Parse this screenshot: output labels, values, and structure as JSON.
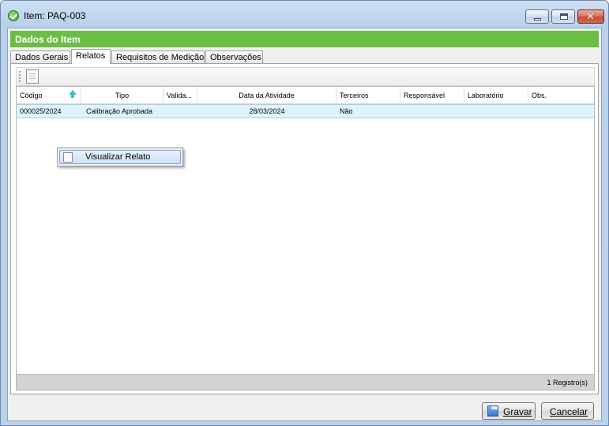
{
  "window": {
    "title": "Item: PAQ-003"
  },
  "section": {
    "header": "Dados do Item"
  },
  "tabs": [
    {
      "label": "Dados Gerais",
      "active": false
    },
    {
      "label": "Relatos",
      "active": true
    },
    {
      "label": "Requisitos de Medição",
      "active": false
    },
    {
      "label": "Observações",
      "active": false
    }
  ],
  "grid": {
    "columns": [
      "Código",
      "Tipo",
      "Valida...",
      "Data da Atividade",
      "Terceiros",
      "Responsável",
      "Laboratório",
      "Obs."
    ],
    "sort_column": "Código",
    "rows": [
      {
        "codigo": "000025/2024",
        "tipo": "Calibração Aprobada",
        "validade": "",
        "data": "28/03/2024",
        "terceiros": "Não",
        "responsavel": "",
        "laboratorio": "",
        "obs": ""
      }
    ],
    "footer": "1  Registro(s)"
  },
  "context_menu": {
    "items": [
      {
        "label": "Visualizar Relato",
        "icon": "document-icon"
      }
    ]
  },
  "buttons": {
    "save": "Gravar",
    "cancel": "Cancelar"
  },
  "colors": {
    "section_header": "#6cbd44",
    "selected_row": "#dff3fb",
    "close_button": "#c24a31"
  }
}
